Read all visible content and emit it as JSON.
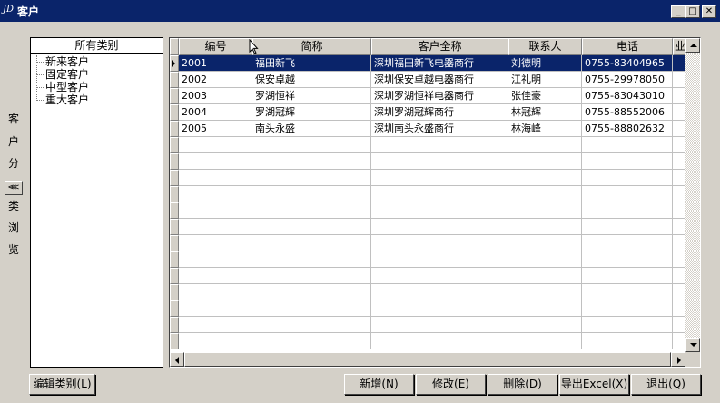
{
  "window": {
    "icon_text": "JD",
    "title": "客户",
    "min_label": "_",
    "max_label": "□",
    "close_label": "✕"
  },
  "left_label": {
    "chars": [
      "客",
      "户",
      "分",
      "类",
      "浏",
      "览"
    ],
    "toggle_label": "<<<"
  },
  "tree": {
    "root_label": "所有类别",
    "items": [
      "新来客户",
      "固定客户",
      "中型客户",
      "重大客户"
    ]
  },
  "grid": {
    "columns": [
      "编号",
      "简称",
      "客户全称",
      "联系人",
      "电话",
      "业"
    ],
    "rows": [
      [
        "2001",
        "福田新飞",
        "深圳福田新飞电器商行",
        "刘德明",
        "0755-83404965"
      ],
      [
        "2002",
        "保安卓越",
        "深圳保安卓越电器商行",
        "江礼明",
        "0755-29978050"
      ],
      [
        "2003",
        "罗湖恒祥",
        "深圳罗湖恒祥电器商行",
        "张佳豪",
        "0755-83043010"
      ],
      [
        "2004",
        "罗湖冠辉",
        "深圳罗湖冠辉商行",
        "林冠辉",
        "0755-88552006"
      ],
      [
        "2005",
        "南头永盛",
        "深圳南头永盛商行",
        "林海峰",
        "0755-88802632"
      ]
    ],
    "selected_row": 0,
    "accent": "#0a246a"
  },
  "buttons": {
    "edit_category": "编辑类别(L)",
    "add": "新增(N)",
    "modify": "修改(E)",
    "delete": "删除(D)",
    "export_excel": "导出Excel(X)",
    "exit": "退出(Q)"
  }
}
